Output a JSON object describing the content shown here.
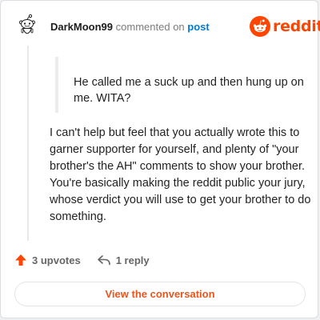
{
  "comment": {
    "username": "DarkMoon99",
    "action_text": "commented on",
    "post_link_label": "post",
    "quoted_text": "He called me a suck up and then hung up on me. WITA?",
    "body": "I can't help but feel that you actually wrote this to garner supporter for yourself, and plenty of \"your brother's the AH\" comments to show your brother. You're basically making the reddit public your jury, whose verdict you will use to get your brother to do something."
  },
  "brand": {
    "name": "reddit",
    "color": "#ff4500"
  },
  "footer": {
    "upvotes_label": "3 upvotes",
    "replies_label": "1 reply",
    "upvote_color": "#ff4500"
  },
  "button": {
    "view_conversation_label": "View the conversation"
  },
  "icons": {
    "avatar": "snoo-avatar-icon",
    "brand": "reddit-logo-icon",
    "upvote": "upvote-arrow-icon",
    "reply": "reply-arrow-icon"
  }
}
